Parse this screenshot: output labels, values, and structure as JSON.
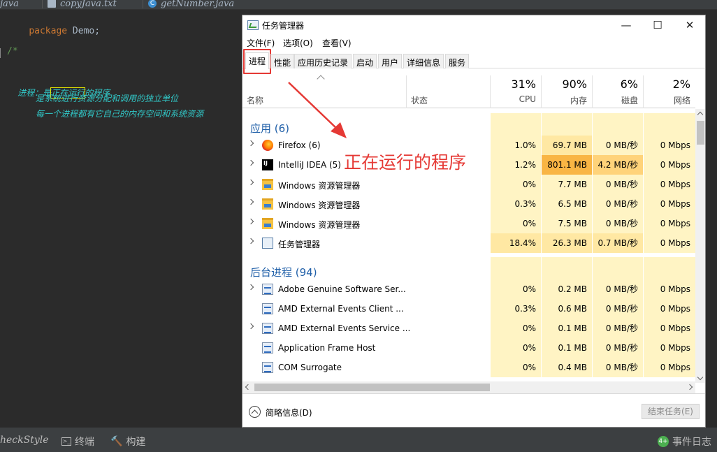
{
  "ide": {
    "tabs": [
      {
        "label": "java",
        "icon": "none"
      },
      {
        "label": "copyJava.txt",
        "icon": "text-file-icon"
      },
      {
        "label": "getNumber.java",
        "icon": "class-icon"
      }
    ],
    "code": {
      "line1_kw": "package",
      "line1_rest": " Demo;",
      "line2": "/*",
      "line3_prefix": "进程：是",
      "line3_highlight": "正在运行",
      "line3_suffix": "的程序",
      "line4": "是系统进行资源分配和调用的独立单位",
      "line5": "每一个进程都有它自己的内存空间和系统资源"
    },
    "bottom": {
      "checkstyle": "heckStyle",
      "terminal": "终端",
      "build": "构建",
      "event_log": "事件日志"
    }
  },
  "taskmgr": {
    "title": "任务管理器",
    "window_buttons": {
      "minimize": "—",
      "maximize": "☐",
      "close": "✕"
    },
    "menu": [
      "文件(F)",
      "选项(O)",
      "查看(V)"
    ],
    "tabs": [
      "进程",
      "性能",
      "应用历史记录",
      "启动",
      "用户",
      "详细信息",
      "服务"
    ],
    "active_tab": "进程",
    "columns": {
      "name": "名称",
      "status": "状态",
      "cpu": {
        "pct": "31%",
        "label": "CPU"
      },
      "memory": {
        "pct": "90%",
        "label": "内存"
      },
      "disk": {
        "pct": "6%",
        "label": "磁盘"
      },
      "network": {
        "pct": "2%",
        "label": "网络"
      }
    },
    "groups": {
      "apps": "应用 (6)",
      "background": "后台进程 (94)"
    },
    "apps": [
      {
        "name": "Firefox (6)",
        "icon": "firefox-icon",
        "cpu": "1.0%",
        "mem": "69.7 MB",
        "disk": "0 MB/秒",
        "net": "0 Mbps"
      },
      {
        "name": "IntelliJ IDEA (5)",
        "icon": "intellij-icon",
        "cpu": "1.2%",
        "mem": "801.1 MB",
        "disk": "4.2 MB/秒",
        "net": "0 Mbps"
      },
      {
        "name": "Windows 资源管理器",
        "icon": "folder-icon",
        "cpu": "0%",
        "mem": "7.7 MB",
        "disk": "0 MB/秒",
        "net": "0 Mbps"
      },
      {
        "name": "Windows 资源管理器",
        "icon": "folder-icon",
        "cpu": "0.3%",
        "mem": "6.5 MB",
        "disk": "0 MB/秒",
        "net": "0 Mbps"
      },
      {
        "name": "Windows 资源管理器",
        "icon": "folder-icon",
        "cpu": "0%",
        "mem": "7.5 MB",
        "disk": "0 MB/秒",
        "net": "0 Mbps"
      },
      {
        "name": "任务管理器",
        "icon": "task-manager-icon",
        "cpu": "18.4%",
        "mem": "26.3 MB",
        "disk": "0.7 MB/秒",
        "net": "0 Mbps"
      }
    ],
    "background": [
      {
        "name": "Adobe Genuine Software Ser...",
        "expandable": true,
        "cpu": "0%",
        "mem": "0.2 MB",
        "disk": "0 MB/秒",
        "net": "0 Mbps"
      },
      {
        "name": "AMD External Events Client ...",
        "expandable": false,
        "cpu": "0.3%",
        "mem": "0.6 MB",
        "disk": "0 MB/秒",
        "net": "0 Mbps"
      },
      {
        "name": "AMD External Events Service ...",
        "expandable": true,
        "cpu": "0%",
        "mem": "0.1 MB",
        "disk": "0 MB/秒",
        "net": "0 Mbps"
      },
      {
        "name": "Application Frame Host",
        "expandable": false,
        "cpu": "0%",
        "mem": "0.1 MB",
        "disk": "0 MB/秒",
        "net": "0 Mbps"
      },
      {
        "name": "COM Surrogate",
        "expandable": false,
        "cpu": "0%",
        "mem": "0.4 MB",
        "disk": "0 MB/秒",
        "net": "0 Mbps"
      }
    ],
    "footer": {
      "fewer_details": "简略信息(D)",
      "end_task": "结束任务(E)"
    }
  },
  "annotation": {
    "text": "正在运行的程序",
    "color": "#e53935"
  },
  "colors": {
    "heat_light": "#fff4c4",
    "heat_medium": "#ffe8a3",
    "heat_strong": "#ffd37a",
    "heat_max": "#f9b544",
    "group_title": "#1f5fa8"
  }
}
